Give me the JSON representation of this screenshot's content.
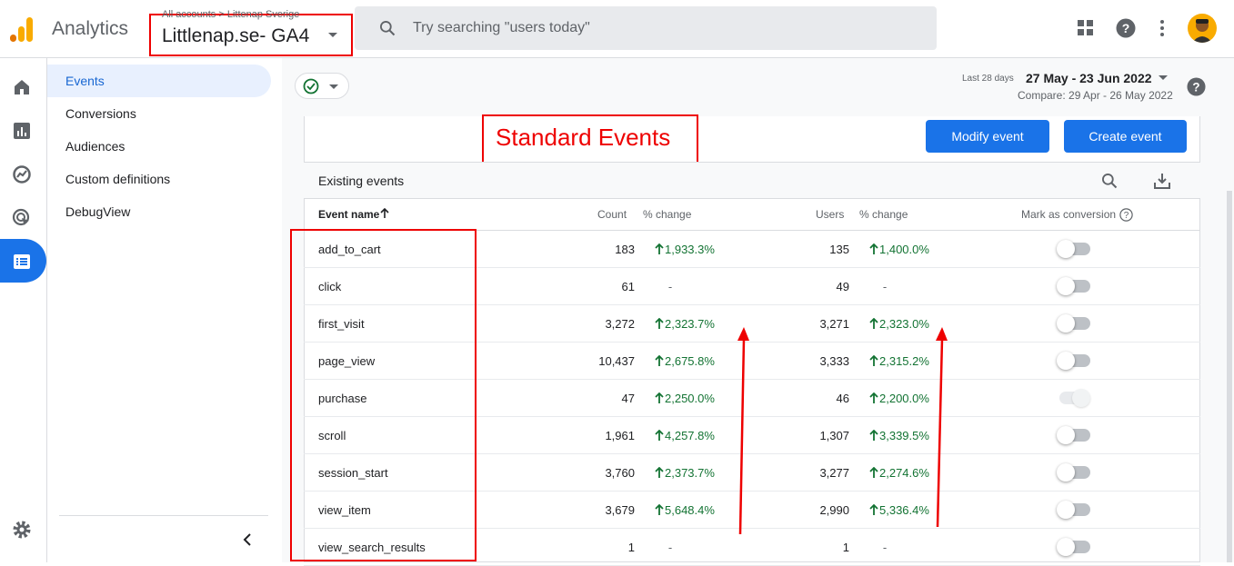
{
  "app": {
    "title": "Analytics",
    "breadcrumb": "All accounts > Littenap Sverige",
    "property": "Littlenap.se- GA4"
  },
  "search": {
    "placeholder": "Try searching \"users today\""
  },
  "sidebar": {
    "items": [
      {
        "label": "Events",
        "active": true
      },
      {
        "label": "Conversions",
        "active": false
      },
      {
        "label": "Audiences",
        "active": false
      },
      {
        "label": "Custom definitions",
        "active": false
      },
      {
        "label": "DebugView",
        "active": false
      }
    ]
  },
  "date": {
    "range_label": "Last 28 days",
    "range": "27 May - 23 Jun 2022",
    "compare": "Compare: 29 Apr - 26 May 2022"
  },
  "annotation": {
    "label": "Standard Events"
  },
  "buttons": {
    "modify": "Modify event",
    "create": "Create event"
  },
  "table": {
    "section_title": "Existing events",
    "headers": {
      "event_name": "Event name",
      "count": "Count",
      "count_change": "% change",
      "users": "Users",
      "users_change": "% change",
      "conversion": "Mark as conversion"
    },
    "rows": [
      {
        "name": "add_to_cart",
        "count": "183",
        "count_change": "1,933.3%",
        "users": "135",
        "users_change": "1,400.0%",
        "conversion_enabled": true
      },
      {
        "name": "click",
        "count": "61",
        "count_change": "-",
        "users": "49",
        "users_change": "-",
        "conversion_enabled": true
      },
      {
        "name": "first_visit",
        "count": "3,272",
        "count_change": "2,323.7%",
        "users": "3,271",
        "users_change": "2,323.0%",
        "conversion_enabled": true
      },
      {
        "name": "page_view",
        "count": "10,437",
        "count_change": "2,675.8%",
        "users": "3,333",
        "users_change": "2,315.2%",
        "conversion_enabled": true
      },
      {
        "name": "purchase",
        "count": "47",
        "count_change": "2,250.0%",
        "users": "46",
        "users_change": "2,200.0%",
        "conversion_enabled": false
      },
      {
        "name": "scroll",
        "count": "1,961",
        "count_change": "4,257.8%",
        "users": "1,307",
        "users_change": "3,339.5%",
        "conversion_enabled": true
      },
      {
        "name": "session_start",
        "count": "3,760",
        "count_change": "2,373.7%",
        "users": "3,277",
        "users_change": "2,274.6%",
        "conversion_enabled": true
      },
      {
        "name": "view_item",
        "count": "3,679",
        "count_change": "5,648.4%",
        "users": "2,990",
        "users_change": "5,336.4%",
        "conversion_enabled": true
      },
      {
        "name": "view_search_results",
        "count": "1",
        "count_change": "-",
        "users": "1",
        "users_change": "-",
        "conversion_enabled": true
      }
    ]
  },
  "colors": {
    "accent": "#1a73e8",
    "positive": "#137333",
    "annotation": "#ee0000"
  }
}
